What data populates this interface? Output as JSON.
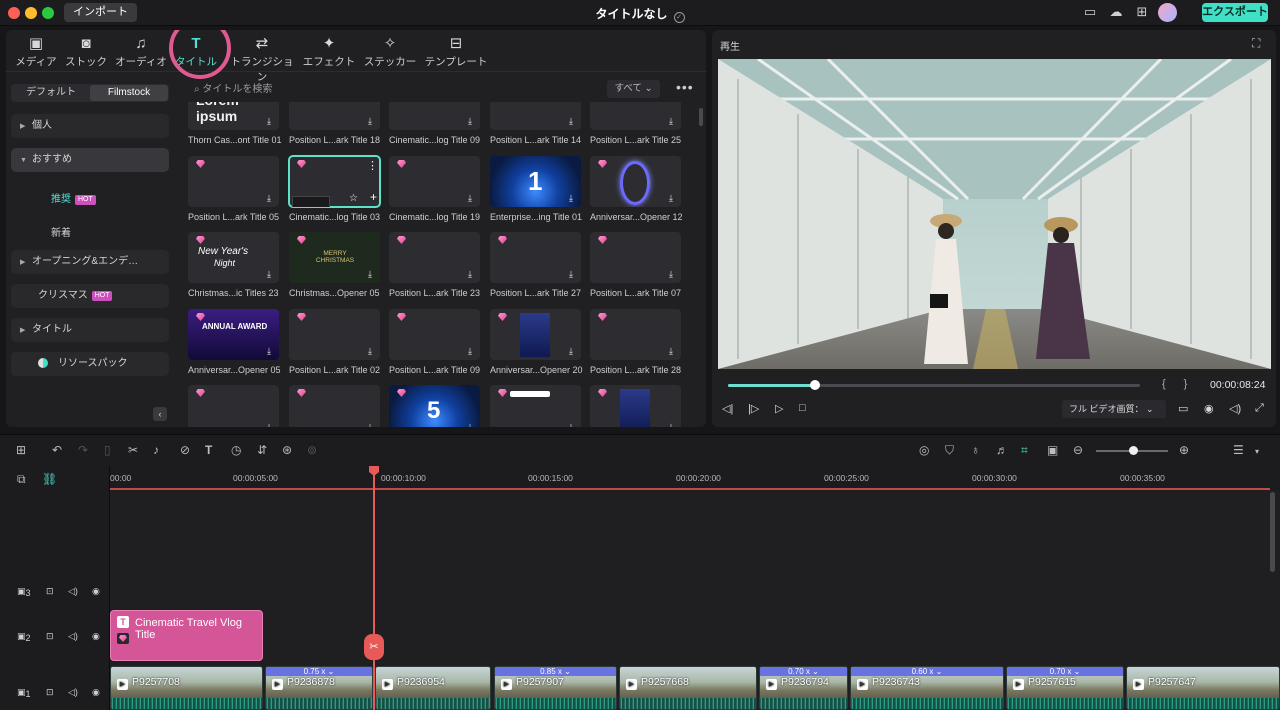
{
  "titlebar": {
    "import_label": "インポート",
    "document_title": "タイトルなし",
    "export_label": "エクスポート",
    "icons": [
      "monitor-icon",
      "cloud-upload-icon",
      "grid-apps-icon",
      "avatar"
    ]
  },
  "library": {
    "tabs": [
      {
        "label": "メディア",
        "icon": "media-icon"
      },
      {
        "label": "ストック",
        "icon": "stock-icon"
      },
      {
        "label": "オーディオ",
        "icon": "music-note-icon"
      },
      {
        "label": "タイトル",
        "icon": "title-t-icon",
        "active": true
      },
      {
        "label": "トランジション",
        "icon": "transition-icon"
      },
      {
        "label": "エフェクト",
        "icon": "effects-icon"
      },
      {
        "label": "ステッカー",
        "icon": "sticker-icon"
      },
      {
        "label": "テンプレート",
        "icon": "template-icon"
      }
    ],
    "segment": {
      "left": "デフォルト",
      "right": "Filmstock"
    },
    "categories": [
      {
        "label": "個人",
        "expandable": true
      },
      {
        "label": "おすすめ",
        "expanded": true,
        "selected": true
      },
      {
        "label": "オープニング&エンデ…",
        "expandable": true
      },
      {
        "label": "クリスマス",
        "badge": "HOT"
      },
      {
        "label": "タイトル",
        "expandable": true
      },
      {
        "label": "リソースパック"
      }
    ],
    "subcategories": [
      {
        "label": "推奨",
        "badge": "HOT",
        "active": true
      },
      {
        "label": "新着"
      }
    ],
    "search_placeholder": "タイトルを検索",
    "filter_label": "すべて",
    "items": [
      "Thorn Cas...ont Title 01",
      "Position L...ark Title 18",
      "Cinematic...log Title 09",
      "Position L...ark Title 14",
      "Position L...ark Title 25",
      "Position L...ark Title 05",
      "Cinematic...log Title 03",
      "Cinematic...log Title 19",
      "Enterprise...ing Title 01",
      "Anniversar...Opener 12",
      "Christmas...ic Titles 23",
      "Christmas...Opener 05",
      "Position L...ark Title 23",
      "Position L...ark Title 27",
      "Position L...ark Title 07",
      "Anniversar...Opener 05",
      "Position L...ark Title 02",
      "Position L...ark Title 09",
      "Anniversar...Opener 20",
      "Position L...ark Title 28",
      "",
      "",
      "",
      "",
      ""
    ],
    "thumb_text": {
      "lorem": "Lorem ipsum",
      "new_year_1": "New Year's",
      "new_year_2": "Night",
      "merry_christmas": "MERRY CHRISTMAS",
      "annual_award": "ANNUAL AWARD",
      "number_1": "1",
      "number_5": "5"
    }
  },
  "preview": {
    "label": "再生",
    "timecode": "00:00:08:24",
    "progress": 0.21,
    "quality_label": "フル ビデオ画質："
  },
  "timeline": {
    "ruler": [
      "00:00",
      "00:00:05:00",
      "00:00:10:00",
      "00:00:15:00",
      "00:00:20:00",
      "00:00:25:00",
      "00:00:30:00",
      "00:00:35:00"
    ],
    "tracks": [
      {
        "label": "3"
      },
      {
        "label": "2"
      },
      {
        "label": "1"
      }
    ],
    "title_clip": {
      "name": "Cinematic Travel Vlog Title"
    },
    "clips": [
      {
        "name": "P9257708",
        "speed": ""
      },
      {
        "name": "P9236878",
        "speed": "0.75 x"
      },
      {
        "name": "P9236954",
        "speed": ""
      },
      {
        "name": "P9257907",
        "speed": "0.85 x"
      },
      {
        "name": "P9257668",
        "speed": ""
      },
      {
        "name": "P9236794",
        "speed": "0.70 x"
      },
      {
        "name": "P9236743",
        "speed": "0.60 x"
      },
      {
        "name": "P9257615",
        "speed": "0.70 x"
      },
      {
        "name": "P9257647",
        "speed": ""
      }
    ],
    "zoom": 0.52
  },
  "colors": {
    "accent": "#4fe0cf",
    "export": "#3fe0c5",
    "title_clip": "#d45598",
    "playhead": "#e85a58",
    "speed_bar": "#6872e0",
    "highlight_ring": "#e05a92"
  }
}
